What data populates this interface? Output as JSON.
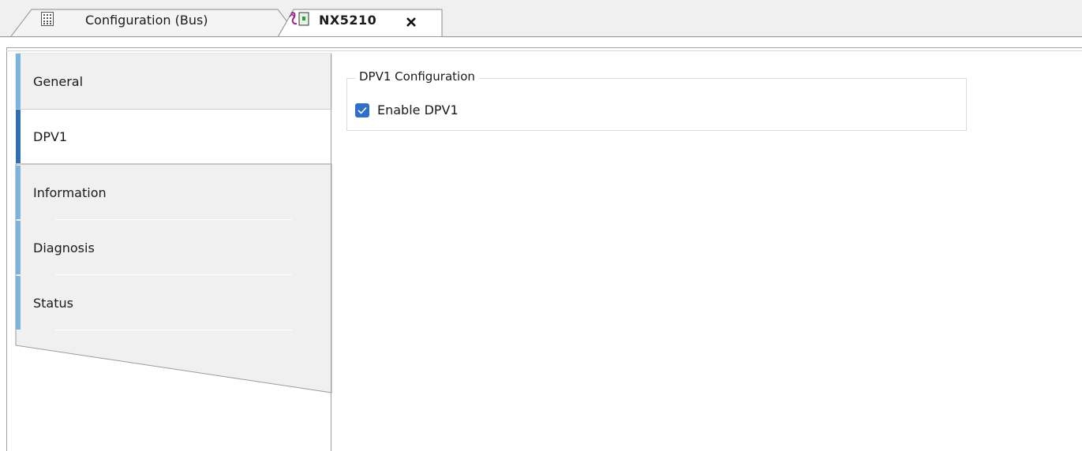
{
  "tabs": [
    {
      "label": "Configuration (Bus)",
      "icon": "grid-document-icon",
      "active": false
    },
    {
      "label": "NX5210",
      "icon": "device-module-icon",
      "active": true,
      "closable": true
    }
  ],
  "sidebar": {
    "items": [
      {
        "label": "General",
        "selected": false
      },
      {
        "label": "DPV1",
        "selected": true
      },
      {
        "label": "Information",
        "selected": false
      },
      {
        "label": "Diagnosis",
        "selected": false
      },
      {
        "label": "Status",
        "selected": false
      }
    ]
  },
  "main": {
    "group_title": "DPV1 Configuration",
    "checkbox": {
      "label": "Enable DPV1",
      "checked": true
    }
  },
  "colors": {
    "accent": "#2f6fc8",
    "nav_accent": "#7cb4e0",
    "nav_accent_selected": "#2f6fb0",
    "panel_bg": "#f0f0f0"
  }
}
